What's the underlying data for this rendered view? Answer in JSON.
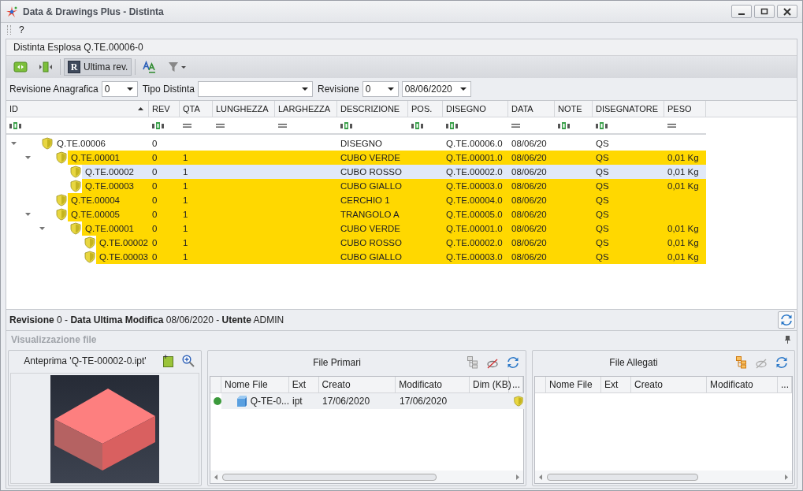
{
  "window": {
    "title": "Data & Drawings Plus - Distinta"
  },
  "menu": [
    {
      "label": "?"
    }
  ],
  "document_tab": {
    "label": "Distinta Esplosa Q.TE.00006-0"
  },
  "toolbar": {
    "revision_button": {
      "icon_letter": "R",
      "label": "Ultima rev.",
      "selected": true
    }
  },
  "filters": [
    {
      "label": "Revisione Anagrafica",
      "value": "0"
    },
    {
      "label": "Tipo Distinta"
    },
    {
      "label": "Revisione",
      "value": "0"
    },
    {
      "value": "08/06/2020"
    }
  ],
  "bom": {
    "columns": [
      {
        "label": "ID",
        "kind": "text",
        "sorted": true
      },
      {
        "label": "REV",
        "kind": "text"
      },
      {
        "label": "QTA",
        "kind": "number"
      },
      {
        "label": "LUNGHEZZA",
        "kind": "number"
      },
      {
        "label": "LARGHEZZA",
        "kind": "number"
      },
      {
        "label": "DESCRIZIONE",
        "kind": "text"
      },
      {
        "label": "POS.",
        "kind": "text"
      },
      {
        "label": "DISEGNO",
        "kind": "text"
      },
      {
        "label": "DATA",
        "kind": "number"
      },
      {
        "label": "NOTE",
        "kind": "text"
      },
      {
        "label": "DISEGNATORE",
        "kind": "text"
      },
      {
        "label": "PESO",
        "kind": "number"
      }
    ],
    "rows": [
      {
        "id": "Q.TE.00006",
        "rev": "0",
        "descrizione": "DISEGNO",
        "disegno": "Q.TE.00006.0",
        "data": "08/06/20",
        "disegnatore": "QS",
        "highlighted": false,
        "selected": false,
        "expanded": true,
        "children": [
          {
            "id": "Q.TE.00001",
            "rev": "0",
            "qta": "1",
            "descrizione": "CUBO VERDE",
            "disegno": "Q.TE.00001.0",
            "data": "08/06/20",
            "disegnatore": "QS",
            "peso": "0,01 Kg",
            "highlighted": true,
            "selected": false,
            "expanded": true,
            "children": [
              {
                "id": "Q.TE.00002",
                "rev": "0",
                "qta": "1",
                "descrizione": "CUBO ROSSO",
                "disegno": "Q.TE.00002.0",
                "data": "08/06/20",
                "disegnatore": "QS",
                "peso": "0,01 Kg",
                "selected": true
              },
              {
                "id": "Q.TE.00003",
                "rev": "0",
                "qta": "1",
                "descrizione": "CUBO GIALLO",
                "disegno": "Q.TE.00003.0",
                "data": "08/06/20",
                "disegnatore": "QS",
                "peso": "0,01 Kg",
                "highlighted": true,
                "selected": false
              }
            ]
          },
          {
            "id": "Q.TE.00004",
            "rev": "0",
            "qta": "1",
            "descrizione": "CERCHIO 1",
            "disegno": "Q.TE.00004.0",
            "data": "08/06/20",
            "disegnatore": "QS",
            "highlighted": true,
            "selected": false
          },
          {
            "id": "Q.TE.00005",
            "rev": "0",
            "qta": "1",
            "descrizione": "TRANGOLO A",
            "disegno": "Q.TE.00005.0",
            "data": "08/06/20",
            "disegnatore": "QS",
            "highlighted": true,
            "selected": false,
            "expanded": true,
            "children": [
              {
                "id": "Q.TE.00001",
                "rev": "0",
                "qta": "1",
                "descrizione": "CUBO VERDE",
                "disegno": "Q.TE.00001.0",
                "data": "08/06/20",
                "disegnatore": "QS",
                "peso": "0,01 Kg",
                "highlighted": true,
                "selected": false,
                "expanded": true,
                "children": [
                  {
                    "id": "Q.TE.00002",
                    "rev": "0",
                    "qta": "1",
                    "descrizione": "CUBO ROSSO",
                    "disegno": "Q.TE.00002.0",
                    "data": "08/06/20",
                    "disegnatore": "QS",
                    "peso": "0,01 Kg",
                    "highlighted": true,
                    "selected": false
                  },
                  {
                    "id": "Q.TE.00003",
                    "rev": "0",
                    "qta": "1",
                    "descrizione": "CUBO GIALLO",
                    "disegno": "Q.TE.00003.0",
                    "data": "08/06/20",
                    "disegnatore": "QS",
                    "peso": "0,01 Kg",
                    "highlighted": true,
                    "selected": false
                  }
                ]
              }
            ]
          }
        ]
      }
    ]
  },
  "status": {
    "text": "**Revisione** 0 - **Data Ultima Modifica** 08/06/2020 - **Utente** ADMIN"
  },
  "file_view": {
    "title": "Visualizzazione file",
    "preview": {
      "title": "Anteprima 'Q-TE-00002-0.ipt'",
      "kind": "picture"
    },
    "primary": {
      "title": "File Primari",
      "columns": [
        "Nome File",
        "Ext",
        "Creato",
        "Modificato",
        "Dim (KB)",
        "..."
      ],
      "rows": [
        {
          "color": "#3c9a3c",
          "name": "Q-TE-0...",
          "ext": "ipt",
          "created": "17/06/2020",
          "modified": "17/06/2020"
        }
      ]
    },
    "attached": {
      "title": "File Allegati",
      "columns": [
        "Nome File",
        "Ext",
        "Creato",
        "Modificato",
        "..."
      ]
    }
  }
}
